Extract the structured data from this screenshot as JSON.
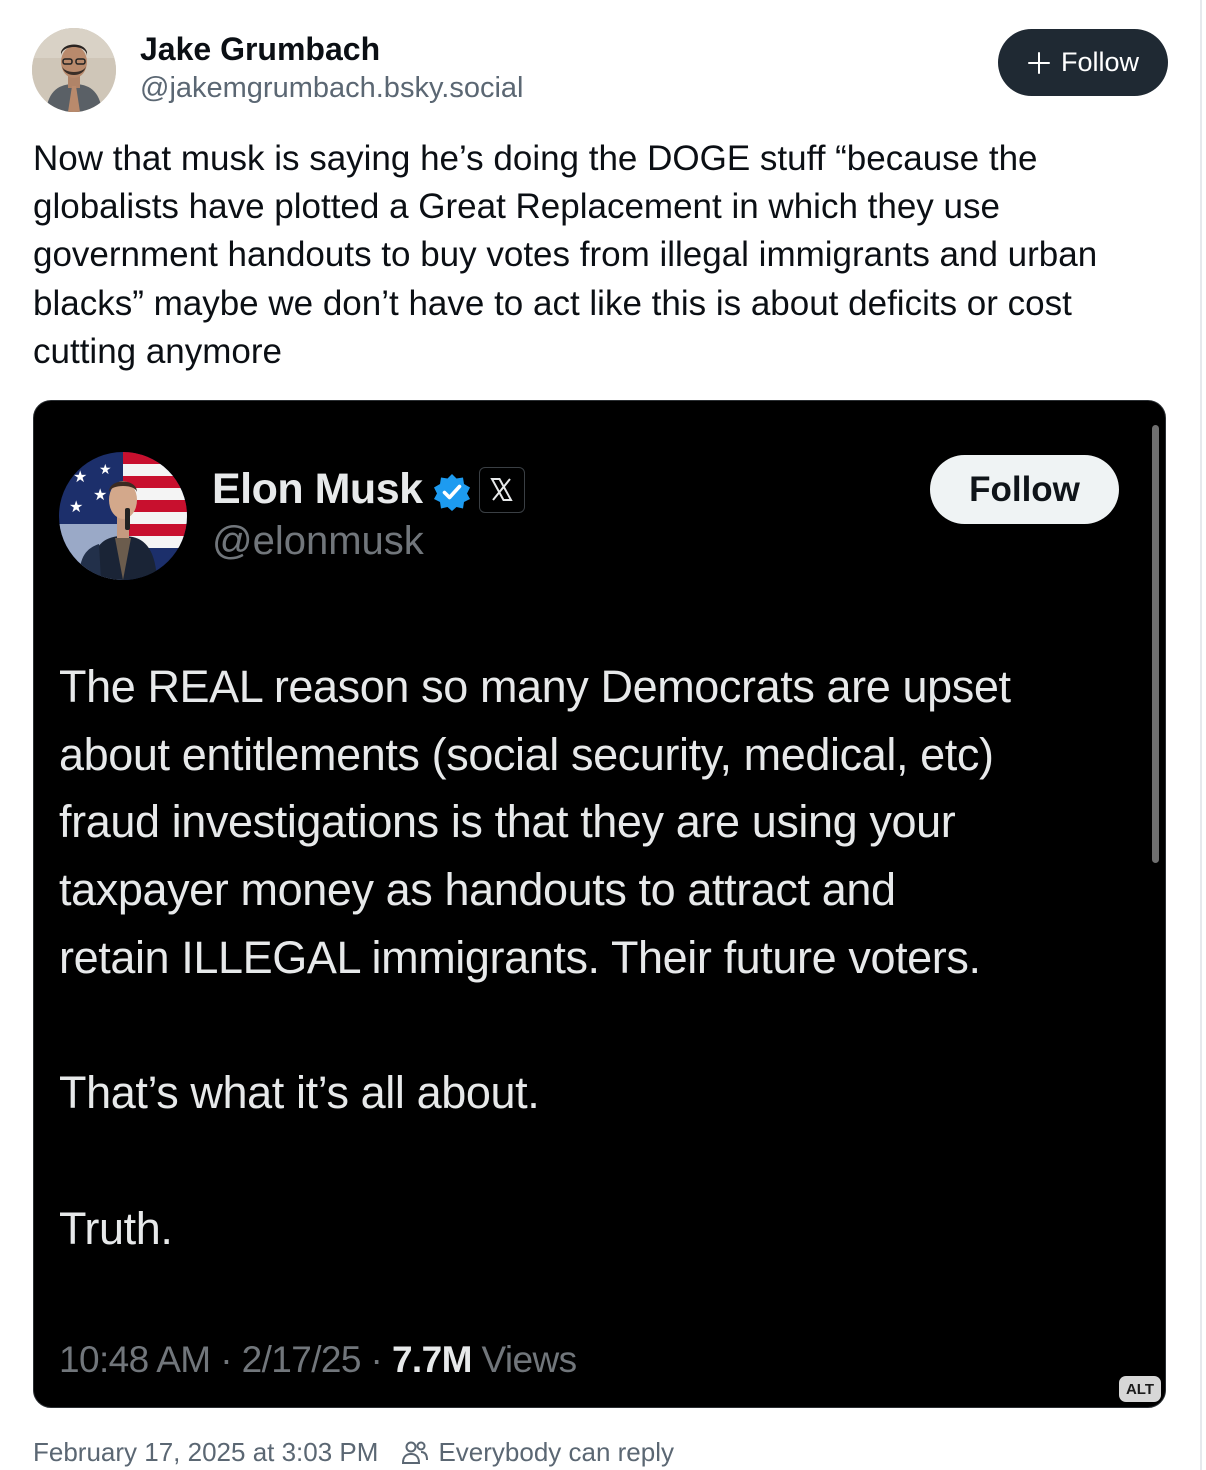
{
  "post": {
    "author_name": "Jake Grumbach",
    "author_handle": "@jakemgrumbach.bsky.social",
    "follow_label": "Follow",
    "text": "Now that musk is saying he’s doing the DOGE stuff “because the globalists have plotted a Great Replacement in which they use government handouts to buy votes from illegal immigrants and urban blacks” maybe we don’t have to act like this is about deficits or cost cutting anymore",
    "timestamp": "February 17, 2025 at 3:03 PM",
    "reply_setting": "Everybody can reply"
  },
  "embed": {
    "author_name": "Elon Musk",
    "author_handle": "@elonmusk",
    "follow_label": "Follow",
    "body_lines": [
      "The REAL reason so many Democrats are upset",
      "about entitlements (social security, medical, etc)",
      "fraud investigations is that they are using your",
      "taxpayer money as handouts to attract and",
      "retain ILLEGAL immigrants. Their future voters."
    ],
    "body_line2": "That’s what it’s all about.",
    "body_line3": "Truth.",
    "meta_time_date": "10:48 AM · 2/17/25 · ",
    "views_count": "7.7M",
    "views_label": " Views",
    "alt_label": "ALT",
    "verified_color": "#1d9bf0"
  },
  "icons": {
    "follow_icon": "plus-icon",
    "verified": "verified-badge-icon",
    "x_logo": "x-logo-icon",
    "reply_setting": "people-icon"
  }
}
